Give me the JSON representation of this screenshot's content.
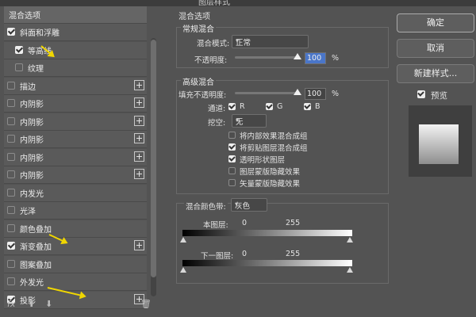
{
  "window": {
    "title": "图层样式"
  },
  "layers_list": {
    "header": "混合选项",
    "items": [
      {
        "label": "斜面和浮雕",
        "checked": true
      },
      {
        "label": "等高线",
        "checked": true
      },
      {
        "label": "纹理",
        "checked": false
      },
      {
        "label": "描边",
        "checked": false
      },
      {
        "label": "内阴影",
        "checked": false
      },
      {
        "label": "内阴影",
        "checked": false
      },
      {
        "label": "内阴影",
        "checked": false
      },
      {
        "label": "内阴影",
        "checked": false
      },
      {
        "label": "内阴影",
        "checked": false
      },
      {
        "label": "内发光",
        "checked": false
      },
      {
        "label": "光泽",
        "checked": false
      },
      {
        "label": "颜色叠加",
        "checked": false
      },
      {
        "label": "渐变叠加",
        "checked": true
      },
      {
        "label": "图案叠加",
        "checked": false
      },
      {
        "label": "外发光",
        "checked": false
      },
      {
        "label": "投影",
        "checked": true
      }
    ],
    "fx_label": "fx"
  },
  "blending": {
    "title": "混合选项",
    "general": {
      "title": "常规混合",
      "mode_label": "混合模式:",
      "mode_value": "正常",
      "opacity_label": "不透明度:",
      "opacity_value": "100",
      "percent": "%"
    },
    "advanced": {
      "title": "高级混合",
      "fill_label": "填充不透明度:",
      "fill_value": "100",
      "percent": "%",
      "channels_label": "通道:",
      "channels": [
        "R",
        "G",
        "B"
      ],
      "knockout_label": "挖空:",
      "knockout_value": "无",
      "options": [
        {
          "label": "将内部效果混合成组",
          "checked": false
        },
        {
          "label": "将剪贴图层混合成组",
          "checked": true
        },
        {
          "label": "透明形状图层",
          "checked": true
        },
        {
          "label": "图层蒙版隐藏效果",
          "checked": false
        },
        {
          "label": "矢量蒙版隐藏效果",
          "checked": false
        }
      ]
    },
    "blend_if": {
      "label": "混合颜色带:",
      "value": "灰色",
      "this_layer_label": "本图层:",
      "this_low": "0",
      "this_high": "255",
      "under_layer_label": "下一图层:",
      "under_low": "0",
      "under_high": "255"
    }
  },
  "buttons": {
    "ok": "确定",
    "cancel": "取消",
    "new_style": "新建样式...",
    "preview_label": "预览",
    "preview_checked": true
  },
  "colors": {
    "accent_arrow": "#f0d600",
    "selection": "#4a76c9"
  }
}
